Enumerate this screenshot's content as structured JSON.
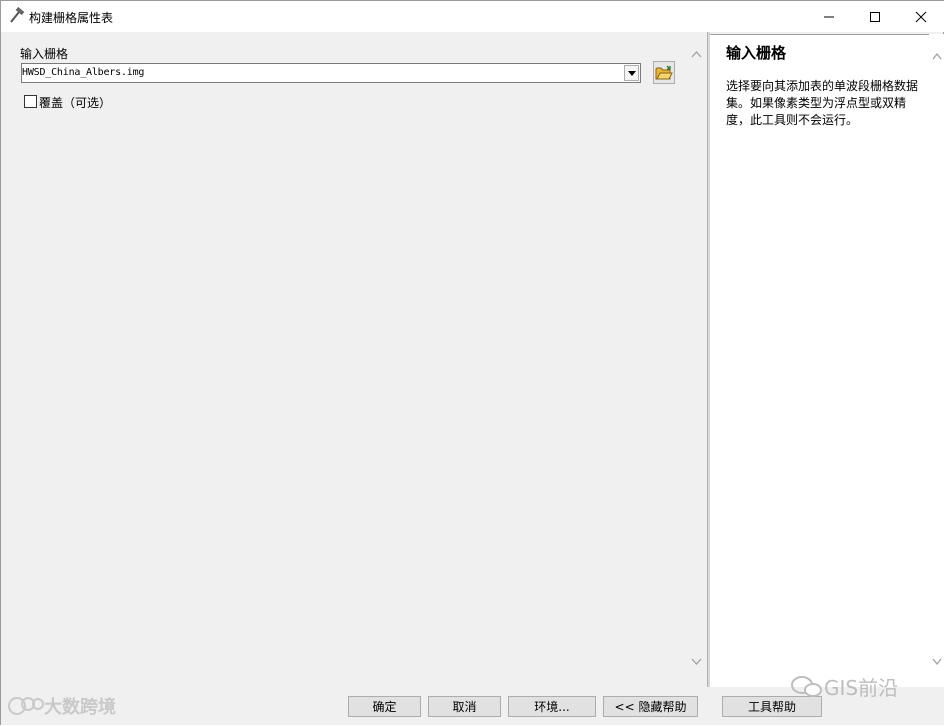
{
  "window": {
    "title": "构建栅格属性表",
    "icon": "hammer-icon"
  },
  "titlebar_buttons": [
    "minimize-icon",
    "maximize-icon",
    "close-icon"
  ],
  "form": {
    "input_raster_label": "输入栅格",
    "input_raster_value": "HWSD_China_Albers.img",
    "overwrite_label": "覆盖（可选）",
    "overwrite_checked": false
  },
  "help_panel": {
    "title": "输入栅格",
    "body": "选择要向其添加表的单波段栅格数据集。如果像素类型为浮点型或双精度，此工具则不会运行。"
  },
  "buttons": {
    "ok": "确定",
    "cancel": "取消",
    "environments": "环境...",
    "hide_help": "<< 隐藏帮助",
    "tool_help": "工具帮助"
  },
  "watermarks": {
    "left": "大数跨境",
    "right": "GIS前沿"
  }
}
